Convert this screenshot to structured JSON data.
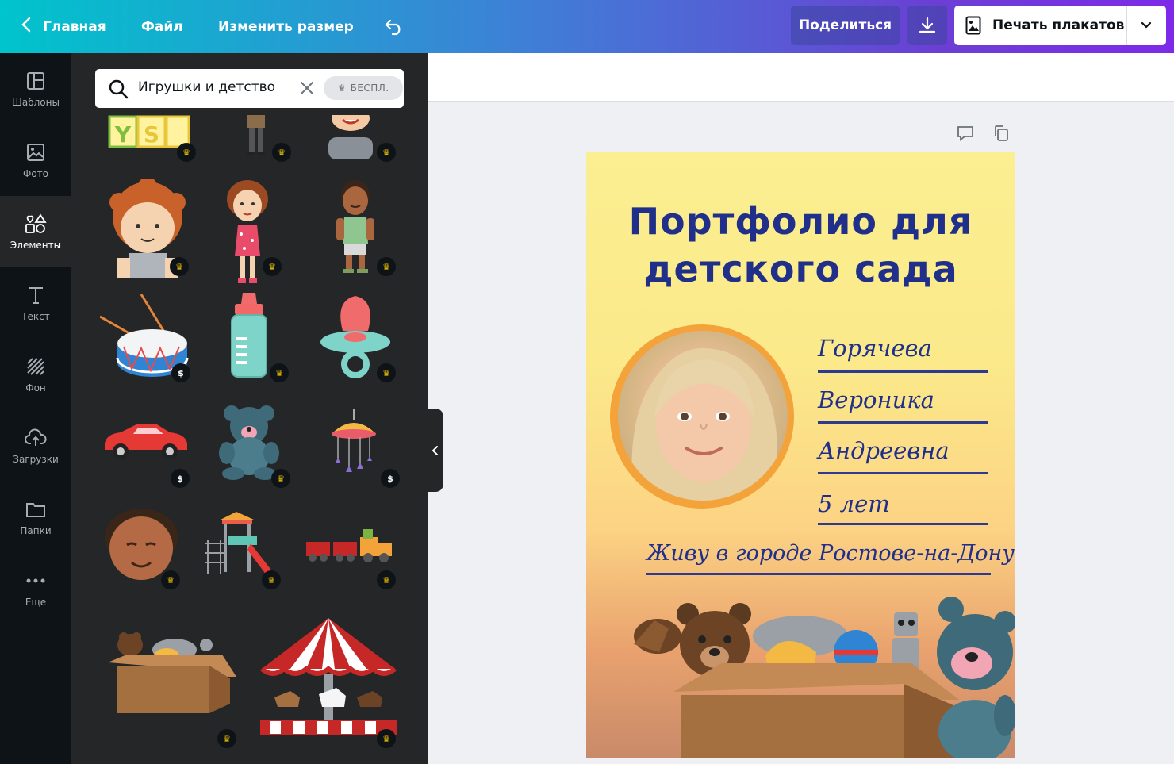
{
  "topbar": {
    "home_label": "Главная",
    "file_label": "Файл",
    "resize_label": "Изменить размер",
    "share_label": "Поделиться",
    "print_label": "Печать плакатов"
  },
  "sidebar": {
    "items": [
      {
        "label": "Шаблоны"
      },
      {
        "label": "Фото"
      },
      {
        "label": "Элементы"
      },
      {
        "label": "Текст"
      },
      {
        "label": "Фон"
      },
      {
        "label": "Загрузки"
      },
      {
        "label": "Папки"
      },
      {
        "label": "Еще"
      }
    ],
    "active": "Элементы"
  },
  "search": {
    "value": "Игрушки и детство",
    "free_badge": "БЕСПЛ."
  },
  "badges": {
    "premium_symbol": "♛",
    "paid_symbol": "$"
  },
  "poster": {
    "title_line1": "Портфолио для",
    "title_line2": "детского сада",
    "surname": "Горячева",
    "name": "Вероника",
    "patronymic": "Андреевна",
    "age": "5 лет",
    "city": "Живу в городе Ростове-на-Дону"
  }
}
